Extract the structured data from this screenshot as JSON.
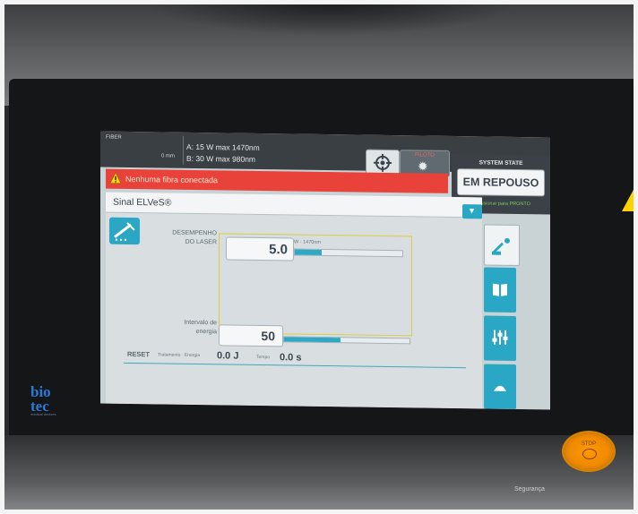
{
  "device": {
    "logo": "bio\ntec",
    "logo_subtitle": "medical devices",
    "stop_label": "STOP",
    "bottom_label": "Segurança"
  },
  "topbar": {
    "fiber_label": "FIBER",
    "fiber_value": "0 mm",
    "spec_a": "A: 15 W max  1470nm",
    "spec_b": "B: 30 W max   980nm",
    "pilot_label": "PILOTO"
  },
  "system_state": {
    "title": "SYSTEM STATE",
    "status": "EM REPOUSO",
    "hint": "Pressionar para PRONTO",
    "hint_color": "#7bd05e"
  },
  "alert": {
    "text": "Nenhuma fibra conectada",
    "color": "#e8423a"
  },
  "signal": {
    "label": "Sinal ELVeS®"
  },
  "laser": {
    "performance_label": "DESEMPENHO\nDO LASER",
    "power_value": "5.0",
    "power_unit": "W · 1470nm",
    "power_level": 0.25
  },
  "energy": {
    "label": "Intervalo de\nenergia",
    "value": "50",
    "level": 0.45
  },
  "counters": {
    "reset_label": "RESET",
    "counter_label": "Tratamento · Energia",
    "counter_value": "0.0 J",
    "time_label": "Tempo",
    "time_value": "0.0 s"
  },
  "icons": {
    "aim": "crosshair-icon",
    "pilot": "gear-icon",
    "alert": "warning-triangle-icon",
    "mode": "laser-handpiece-icon",
    "side_1": "manual-book-icon",
    "side_2": "sliders-icon",
    "side_3": "treatment-icon"
  },
  "colors": {
    "accent": "#2aa7c4",
    "screen_bg": "#c9d2d4",
    "stop": "#ff9a00"
  }
}
